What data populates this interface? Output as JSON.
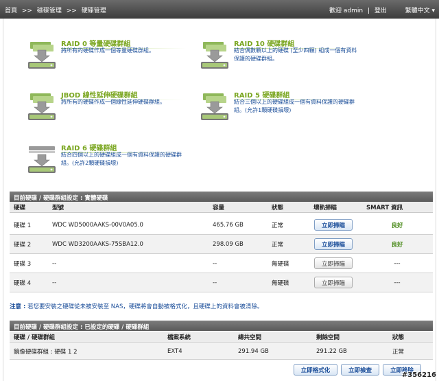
{
  "topbar": {
    "crumbs": [
      "首頁",
      ">>",
      "磁碟管理",
      ">>",
      "硬碟管理"
    ],
    "welcome": "歡迎 admin",
    "logout": "登出",
    "language": "繁體中文"
  },
  "raid_types": [
    {
      "title": "RAID 0 等量硬碟群組",
      "desc": "將所有的硬碟作成一個等量硬碟群組。",
      "icon": "raid0-disk-icon"
    },
    {
      "title": "RAID 10 硬碟群組",
      "desc": "結合偶數顆以上的硬碟 (至少四顆) 組成一個有資料保護的硬碟群組。",
      "icon": "raid10-disk-icon"
    },
    {
      "title": "JBOD 線性延伸硬碟群組",
      "desc": "將所有的硬碟作成一個線性延伸硬碟群組。",
      "icon": "jbod-disk-icon"
    },
    {
      "title": "RAID 5 硬碟群組",
      "desc": "結合三個以上的硬碟組成一個有資料保護的硬碟群組。(允許1顆硬碟損壞)",
      "icon": "raid5-disk-icon"
    },
    {
      "title": "RAID 6 硬碟群組",
      "desc": "結合四個以上的硬碟組成一個有資料保護的硬碟群組。(允許2顆硬碟損壞)",
      "icon": "raid6-disk-icon"
    }
  ],
  "disks_panel": {
    "title": "目前硬碟 / 硬碟群組設定 : 實體硬碟",
    "columns": [
      "硬碟",
      "型號",
      "容量",
      "狀態",
      "壞軌掃瞄",
      "SMART 資訊"
    ],
    "rows": [
      {
        "disk": "硬碟 1",
        "model": "WDC WD5000AAKS-00V0A05.0",
        "capacity": "465.76 GB",
        "status": "正常",
        "scan": "立即掃瞄",
        "smart": "良好",
        "active": true
      },
      {
        "disk": "硬碟 2",
        "model": "WDC WD3200AAKS-75SBA12.0",
        "capacity": "298.09 GB",
        "status": "正常",
        "scan": "立即掃瞄",
        "smart": "良好",
        "active": true
      },
      {
        "disk": "硬碟 3",
        "model": "--",
        "capacity": "--",
        "status": "無硬碟",
        "scan": "立即掃瞄",
        "smart": "---",
        "active": false
      },
      {
        "disk": "硬碟 4",
        "model": "--",
        "capacity": "--",
        "status": "無硬碟",
        "scan": "立即掃瞄",
        "smart": "---",
        "active": false
      }
    ]
  },
  "note": {
    "label": "注意 :",
    "text": "若您要安裝之硬碟從未被安裝至 NAS，硬碟將會自動被格式化，且硬碟上的資料會被清除。"
  },
  "groups_panel": {
    "title": "目前硬碟 / 硬碟群組設定 : 已設定的硬碟 / 硬碟群組",
    "columns": [
      "硬碟 / 硬碟群組",
      "檔案系統",
      "總共空間",
      "剩餘空間",
      "狀態"
    ],
    "rows": [
      {
        "name": "鏡像硬碟群組 : 硬碟 1 2",
        "fs": "EXT4",
        "total": "291.94 GB",
        "free": "291.22 GB",
        "status": "正常"
      }
    ],
    "buttons": {
      "format": "立即格式化",
      "check": "立即檢查",
      "remove": "立即移除"
    }
  },
  "watermark": "#356216",
  "colors": {
    "accent_green": "#7aa620",
    "link_blue": "#1a4d99",
    "header_gray": "#5a5a5a"
  }
}
